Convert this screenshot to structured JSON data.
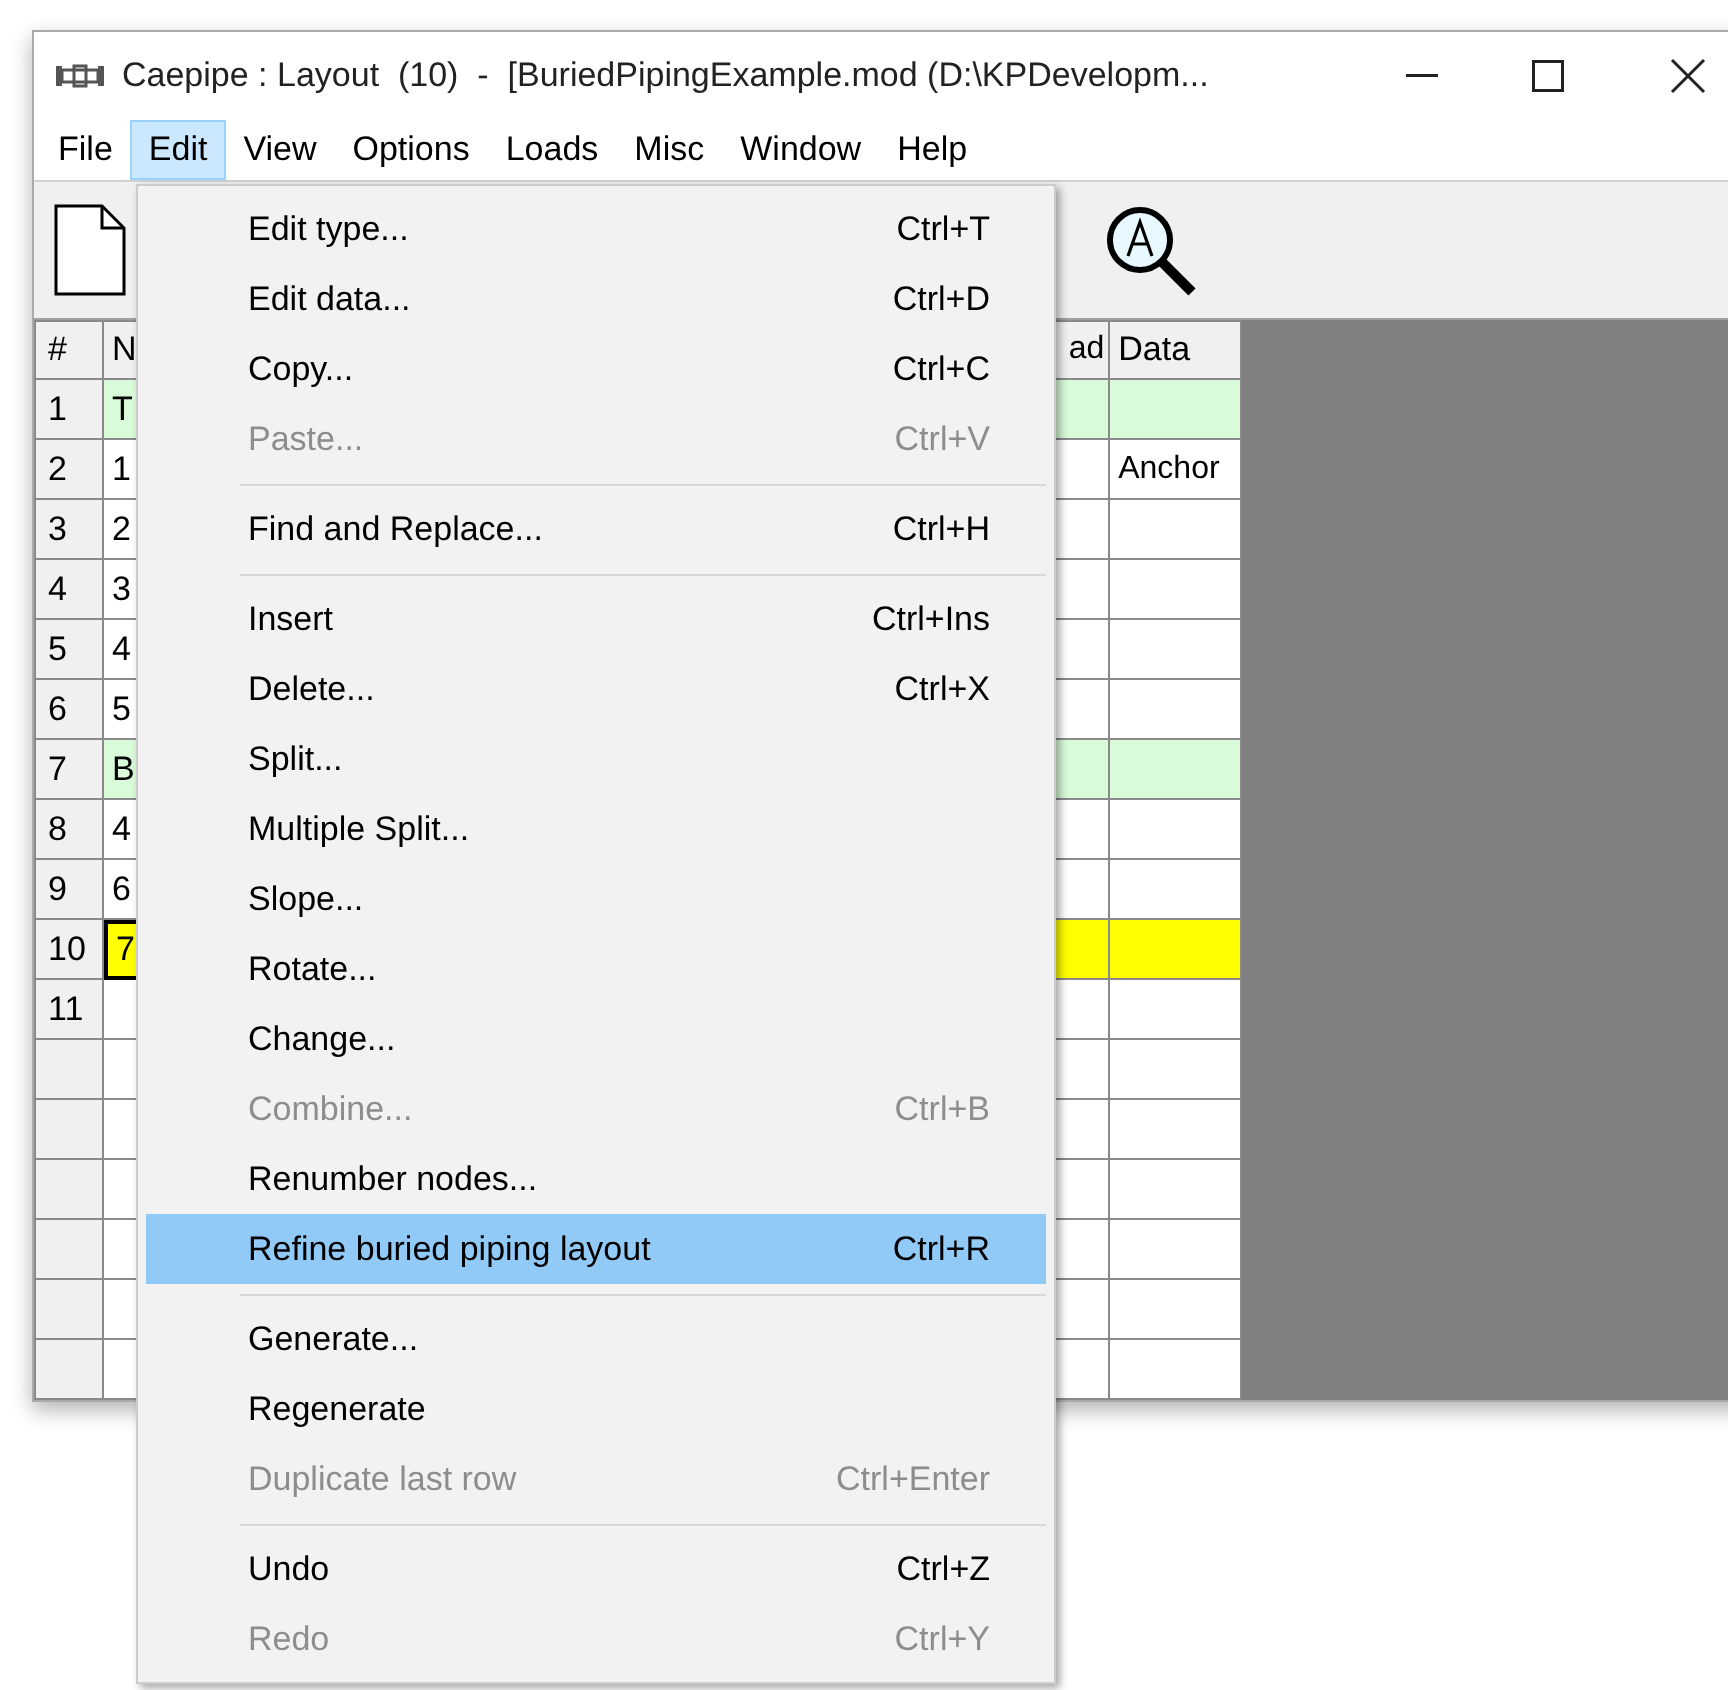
{
  "window": {
    "title": "Caepipe : Layout  (10)  -  [BuriedPipingExample.mod (D:\\KPDevelopm..."
  },
  "menu_bar": [
    {
      "label": "File",
      "selected": false
    },
    {
      "label": "Edit",
      "selected": true
    },
    {
      "label": "View",
      "selected": false
    },
    {
      "label": "Options",
      "selected": false
    },
    {
      "label": "Loads",
      "selected": false
    },
    {
      "label": "Misc",
      "selected": false
    },
    {
      "label": "Window",
      "selected": false
    },
    {
      "label": "Help",
      "selected": false
    }
  ],
  "table": {
    "columns": [
      "#",
      "N",
      "ad",
      "Data"
    ],
    "rows": [
      {
        "number": "1",
        "column_2": "T",
        "color": "#d9fbd9",
        "selected": false
      },
      {
        "number": "2",
        "column_2": "1",
        "data": "Anchor",
        "color": "#ffffff",
        "selected": false
      },
      {
        "number": "3",
        "column_2": "2",
        "color": "#ffffff",
        "selected": false
      },
      {
        "number": "4",
        "column_2": "3",
        "color": "#ffffff",
        "selected": false
      },
      {
        "number": "5",
        "column_2": "4",
        "color": "#ffffff",
        "selected": false
      },
      {
        "number": "6",
        "column_2": "5",
        "color": "#ffffff",
        "selected": false
      },
      {
        "number": "7",
        "column_2": "B",
        "color": "#d9fbd9",
        "selected": false
      },
      {
        "number": "8",
        "column_2": "4",
        "color": "#ffffff",
        "selected": false
      },
      {
        "number": "9",
        "column_2": "6",
        "color": "#ffffff",
        "selected": false
      },
      {
        "number": "10",
        "column_2": "7",
        "color": "#ffff00",
        "selected": true
      },
      {
        "number": "11",
        "color": "#ffffff",
        "selected": false
      }
    ]
  },
  "edit_menu": [
    {
      "kind": "item",
      "label": "Edit type...",
      "shortcut": "Ctrl+T",
      "disabled": false,
      "selected": false
    },
    {
      "kind": "item",
      "label": "Edit data...",
      "shortcut": "Ctrl+D",
      "disabled": false,
      "selected": false
    },
    {
      "kind": "item",
      "label": "Copy...",
      "shortcut": "Ctrl+C",
      "disabled": false,
      "selected": false
    },
    {
      "kind": "item",
      "label": "Paste...",
      "shortcut": "Ctrl+V",
      "disabled": true,
      "selected": false
    },
    {
      "kind": "separator"
    },
    {
      "kind": "item",
      "label": "Find and Replace...",
      "shortcut": "Ctrl+H",
      "disabled": false,
      "selected": false
    },
    {
      "kind": "separator"
    },
    {
      "kind": "item",
      "label": "Insert",
      "shortcut": "Ctrl+Ins",
      "disabled": false,
      "selected": false
    },
    {
      "kind": "item",
      "label": "Delete...",
      "shortcut": "Ctrl+X",
      "disabled": false,
      "selected": false
    },
    {
      "kind": "item",
      "label": "Split...",
      "disabled": false,
      "selected": false
    },
    {
      "kind": "item",
      "label": "Multiple Split...",
      "disabled": false,
      "selected": false
    },
    {
      "kind": "item",
      "label": "Slope...",
      "disabled": false,
      "selected": false
    },
    {
      "kind": "item",
      "label": "Rotate...",
      "disabled": false,
      "selected": false
    },
    {
      "kind": "item",
      "label": "Change...",
      "disabled": false,
      "selected": false
    },
    {
      "kind": "item",
      "label": "Combine...",
      "shortcut": "Ctrl+B",
      "disabled": true,
      "selected": false
    },
    {
      "kind": "item",
      "label": "Renumber nodes...",
      "disabled": false,
      "selected": false
    },
    {
      "kind": "item",
      "label": "Refine buried piping layout",
      "shortcut": "Ctrl+R",
      "disabled": false,
      "selected": true
    },
    {
      "kind": "separator"
    },
    {
      "kind": "item",
      "label": "Generate...",
      "disabled": false,
      "selected": false
    },
    {
      "kind": "item",
      "label": "Regenerate",
      "disabled": false,
      "selected": false
    },
    {
      "kind": "item",
      "label": "Duplicate last row",
      "shortcut": "Ctrl+Enter",
      "disabled": true,
      "selected": false
    },
    {
      "kind": "separator"
    },
    {
      "kind": "item",
      "label": "Undo",
      "shortcut": "Ctrl+Z",
      "disabled": false,
      "selected": false
    },
    {
      "kind": "item",
      "label": "Redo",
      "shortcut": "Ctrl+Y",
      "disabled": true,
      "selected": false
    }
  ]
}
